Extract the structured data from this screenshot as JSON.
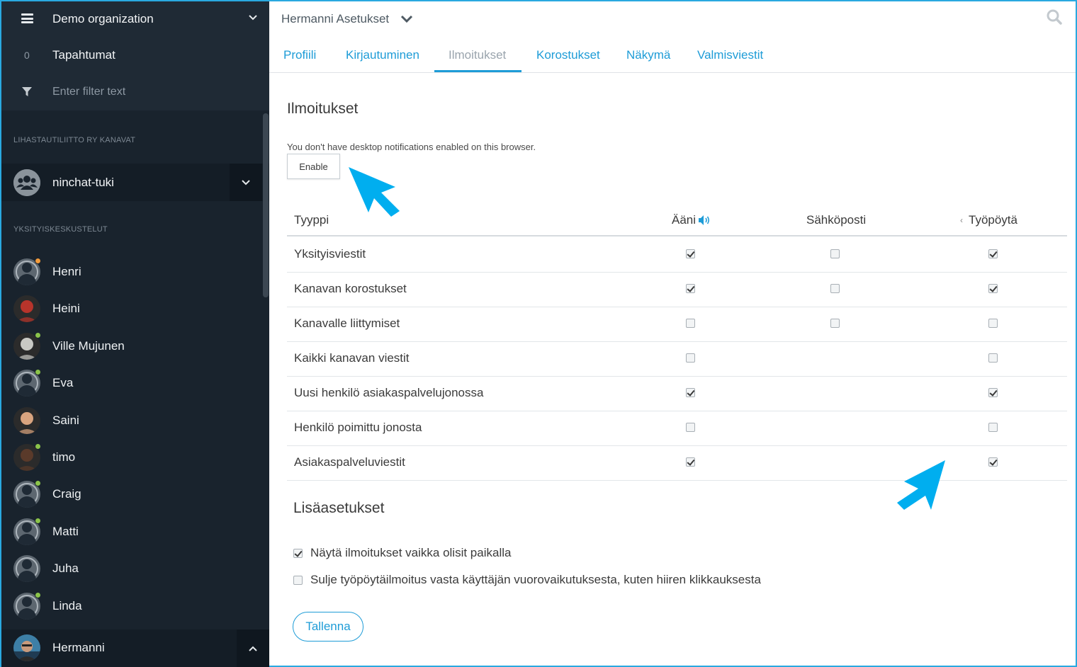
{
  "sidebar": {
    "org_name": "Demo organization",
    "events_count": "0",
    "events_label": "Tapahtumat",
    "filter_placeholder": "Enter filter text",
    "channels_title": "LIHASTAUTILIITTO RY KANAVAT",
    "channel_name": "ninchat-tuki",
    "private_title": "YKSITYISKESKUSTELUT",
    "contacts": [
      {
        "name": "Henri",
        "status": "away",
        "photo": false
      },
      {
        "name": "Heini",
        "status": "none",
        "photo": true,
        "photo_color": "#b8342b"
      },
      {
        "name": "Ville Mujunen",
        "status": "online",
        "photo": true,
        "photo_color": "#c9c9c4"
      },
      {
        "name": "Eva",
        "status": "online",
        "photo": false
      },
      {
        "name": "Saini",
        "status": "none",
        "photo": true,
        "photo_color": "#d9a47f"
      },
      {
        "name": "timo",
        "status": "online",
        "photo": true,
        "photo_color": "#5a3a2a"
      },
      {
        "name": "Craig",
        "status": "online",
        "photo": false
      },
      {
        "name": "Matti",
        "status": "online",
        "photo": false
      },
      {
        "name": "Juha",
        "status": "none",
        "photo": false
      },
      {
        "name": "Linda",
        "status": "online",
        "photo": false
      }
    ],
    "current_user": "Hermanni"
  },
  "header": {
    "title": "Hermanni Asetukset"
  },
  "tabs": [
    {
      "label": "Profiili",
      "active": false
    },
    {
      "label": "Kirjautuminen",
      "active": false
    },
    {
      "label": "Ilmoitukset",
      "active": true
    },
    {
      "label": "Korostukset",
      "active": false
    },
    {
      "label": "Näkymä",
      "active": false
    },
    {
      "label": "Valmisviestit",
      "active": false
    }
  ],
  "notifications": {
    "heading": "Ilmoitukset",
    "notice": "You don't have desktop notifications enabled on this browser.",
    "enable_label": "Enable",
    "columns": {
      "type": "Tyyppi",
      "sound": "Ääni",
      "email": "Sähköposti",
      "desktop": "Työpöytä"
    },
    "rows": [
      {
        "label": "Yksityisviestit",
        "sound": true,
        "email": false,
        "desktop": true
      },
      {
        "label": "Kanavan korostukset",
        "sound": true,
        "email": false,
        "desktop": true
      },
      {
        "label": "Kanavalle liittymiset",
        "sound": false,
        "email": false,
        "desktop": false
      },
      {
        "label": "Kaikki kanavan viestit",
        "sound": false,
        "email": null,
        "desktop": false
      },
      {
        "label": "Uusi henkilö asiakaspalvelujonossa",
        "sound": true,
        "email": null,
        "desktop": true
      },
      {
        "label": "Henkilö poimittu jonosta",
        "sound": false,
        "email": null,
        "desktop": false
      },
      {
        "label": "Asiakaspalveluviestit",
        "sound": true,
        "email": null,
        "desktop": true
      }
    ]
  },
  "more": {
    "heading": "Lisäasetukset",
    "options": [
      {
        "label": "Näytä ilmoitukset vaikka olisit paikalla",
        "checked": true
      },
      {
        "label": "Sulje työpöytäilmoitus vasta käyttäjän vuorovaikutuksesta, kuten hiiren klikkauksesta",
        "checked": false
      }
    ],
    "save_label": "Tallenna"
  },
  "colors": {
    "accent": "#1e9cd7",
    "sidebar_bg": "#19232d",
    "online": "#8bc34a",
    "away": "#f39c3d",
    "annotation_arrow": "#00aeef"
  }
}
